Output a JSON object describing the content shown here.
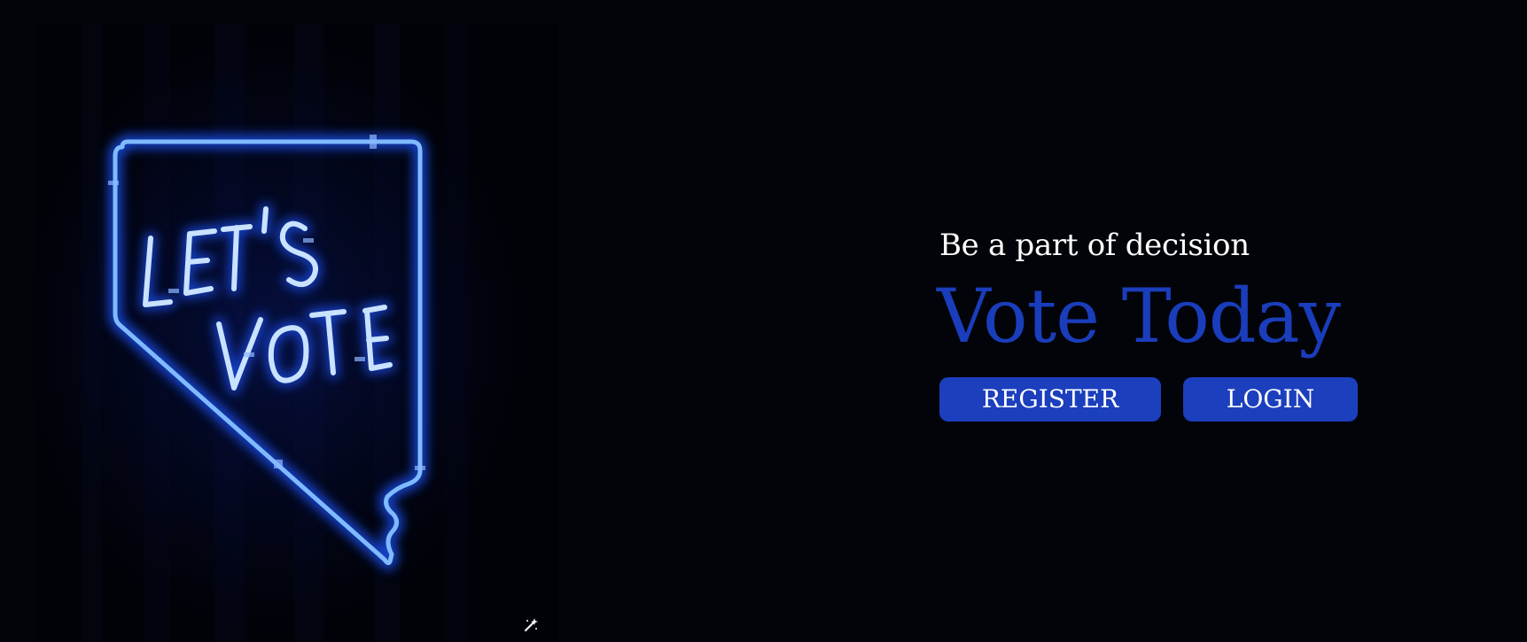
{
  "image": {
    "alt": "LET'S VOTE",
    "sign_line1": "LET'S",
    "sign_line2": "VOTE",
    "icon": "magic-wand-icon"
  },
  "hero": {
    "subtitle": "Be a part of decision",
    "title": "Vote Today"
  },
  "actions": {
    "register_label": "REGISTER",
    "login_label": "LOGIN"
  },
  "colors": {
    "background": "#02040a",
    "accent": "#1b3fbd",
    "neon": "#6fb2ff",
    "text": "#ffffff"
  }
}
